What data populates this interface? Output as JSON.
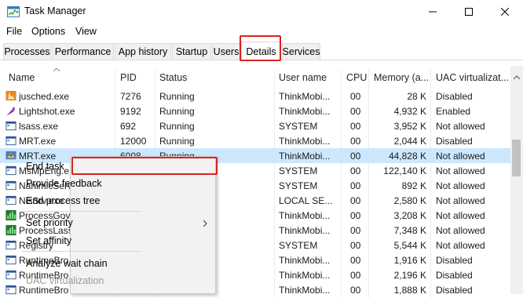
{
  "window": {
    "title": "Task Manager"
  },
  "menu": [
    "File",
    "Options",
    "View"
  ],
  "tabs": [
    {
      "label": "Processes",
      "active": false
    },
    {
      "label": "Performance",
      "active": false
    },
    {
      "label": "App history",
      "active": false
    },
    {
      "label": "Startup",
      "active": false
    },
    {
      "label": "Users",
      "active": false
    },
    {
      "label": "Details",
      "active": true,
      "highlighted": true
    },
    {
      "label": "Services",
      "active": false
    }
  ],
  "table": {
    "columns": [
      "Name",
      "PID",
      "Status",
      "User name",
      "CPU",
      "Memory (a...",
      "UAC virtualizat..."
    ],
    "rows": [
      {
        "name": "jusched.exe",
        "pid": "7276",
        "status": "Running",
        "user": "ThinkMobi...",
        "cpu": "00",
        "mem": "28 K",
        "uac": "Disabled",
        "icon": "java-icon"
      },
      {
        "name": "Lightshot.exe",
        "pid": "9192",
        "status": "Running",
        "user": "ThinkMobi...",
        "cpu": "00",
        "mem": "4,932 K",
        "uac": "Enabled",
        "icon": "feather-icon"
      },
      {
        "name": "lsass.exe",
        "pid": "692",
        "status": "Running",
        "user": "SYSTEM",
        "cpu": "00",
        "mem": "3,952 K",
        "uac": "Not allowed",
        "icon": "window-app-icon"
      },
      {
        "name": "MRT.exe",
        "pid": "12000",
        "status": "Running",
        "user": "ThinkMobi...",
        "cpu": "00",
        "mem": "2,044 K",
        "uac": "Disabled",
        "icon": "window-app-icon"
      },
      {
        "name": "MRT.exe",
        "pid": "6008",
        "status": "Running",
        "user": "ThinkMobi...",
        "cpu": "00",
        "mem": "44,828 K",
        "uac": "Not allowed",
        "icon": "mrt-icon",
        "selected": true
      },
      {
        "name": "MsMpEng.e",
        "pid": "",
        "status": "",
        "user": "SYSTEM",
        "cpu": "00",
        "mem": "122,140 K",
        "uac": "Not allowed",
        "icon": "window-app-icon"
      },
      {
        "name": "NahimicServ",
        "pid": "",
        "status": "",
        "user": "SYSTEM",
        "cpu": "00",
        "mem": "892 K",
        "uac": "Not allowed",
        "icon": "window-app-icon"
      },
      {
        "name": "NisSrv.exe",
        "pid": "",
        "status": "",
        "user": "LOCAL SE...",
        "cpu": "00",
        "mem": "2,580 K",
        "uac": "Not allowed",
        "icon": "window-app-icon"
      },
      {
        "name": "ProcessGove",
        "pid": "",
        "status": "",
        "user": "ThinkMobi...",
        "cpu": "00",
        "mem": "3,208 K",
        "uac": "Not allowed",
        "icon": "chart-green-icon"
      },
      {
        "name": "ProcessLasso",
        "pid": "",
        "status": "",
        "user": "ThinkMobi...",
        "cpu": "00",
        "mem": "7,348 K",
        "uac": "Not allowed",
        "icon": "chart-green-icon"
      },
      {
        "name": "Registry",
        "pid": "",
        "status": "",
        "user": "SYSTEM",
        "cpu": "00",
        "mem": "5,544 K",
        "uac": "Not allowed",
        "icon": "window-app-icon"
      },
      {
        "name": "RuntimeBro",
        "pid": "",
        "status": "",
        "user": "ThinkMobi...",
        "cpu": "00",
        "mem": "1,916 K",
        "uac": "Disabled",
        "icon": "window-app-icon"
      },
      {
        "name": "RuntimeBro",
        "pid": "",
        "status": "",
        "user": "ThinkMobi...",
        "cpu": "00",
        "mem": "2,196 K",
        "uac": "Disabled",
        "icon": "window-app-icon"
      },
      {
        "name": "RuntimeBro",
        "pid": "",
        "status": "",
        "user": "ThinkMobi...",
        "cpu": "00",
        "mem": "1,888 K",
        "uac": "Disabled",
        "icon": "window-app-icon"
      }
    ]
  },
  "context_menu": {
    "items": [
      {
        "label": "End task",
        "highlighted": true
      },
      {
        "label": "Provide feedback"
      },
      {
        "label": "End process tree"
      },
      {
        "label": "Set priority",
        "submenu": true
      },
      {
        "label": "Set affinity"
      },
      {
        "label": "Analyze wait chain"
      },
      {
        "label": "UAC virtualization",
        "disabled": true
      }
    ]
  },
  "colors": {
    "highlight_red": "#d9241c",
    "selected_row": "#cce8ff"
  }
}
